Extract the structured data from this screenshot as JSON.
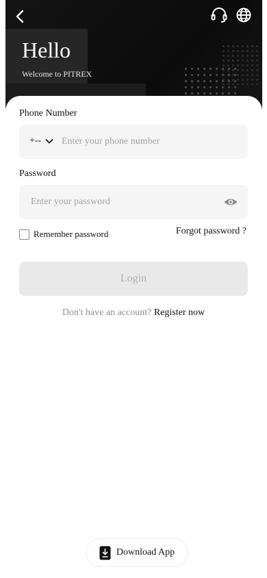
{
  "header": {
    "title": "Hello",
    "subtitle": "Welcome to PITREX",
    "icons": {
      "back": "chevron-left-icon",
      "support": "headset-icon",
      "language": "globe-icon"
    }
  },
  "form": {
    "phone_label": "Phone Number",
    "country_code": "+--",
    "phone_placeholder": "Enter your phone number",
    "phone_value": "",
    "password_label": "Password",
    "password_placeholder": "Enter your password",
    "password_value": "",
    "remember_label": "Remember password",
    "remember_checked": false,
    "forgot_label": "Forgot password ?",
    "login_label": "Login"
  },
  "register": {
    "prompt": "Don't have an account?",
    "link": "Register now"
  },
  "download": {
    "label": "Download App",
    "icon": "download-phone-icon"
  },
  "colors": {
    "hero_bg": "#141414",
    "field_bg": "#f5f5f5",
    "login_disabled_bg": "#e9e9e9",
    "muted_text": "#8d8d8d"
  }
}
